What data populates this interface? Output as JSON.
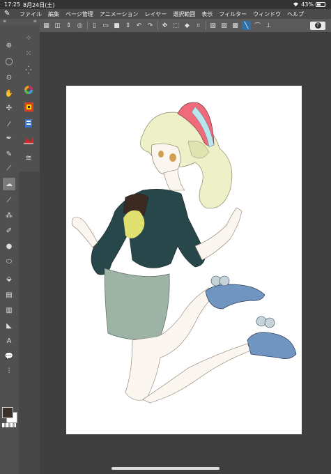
{
  "status_bar": {
    "time": "17:25",
    "date": "8月24日(土)",
    "battery": "43%",
    "battery_level": 0.43
  },
  "menu": {
    "items": [
      "ファイル",
      "編集",
      "ページ管理",
      "アニメーション",
      "レイヤー",
      "選択範囲",
      "表示",
      "フィルター",
      "ウィンドウ",
      "ヘルプ"
    ]
  },
  "tool_header": {
    "left": "«",
    "right": "«"
  },
  "command_bar": {
    "help_label": "?"
  },
  "canvas": {
    "background": "#ffffff",
    "illustration": "jumping-girl-with-cap"
  },
  "colors": {
    "main_color": "#3a3028",
    "sub_color": "#ffffff",
    "accent_active": "#2d6fa6"
  }
}
